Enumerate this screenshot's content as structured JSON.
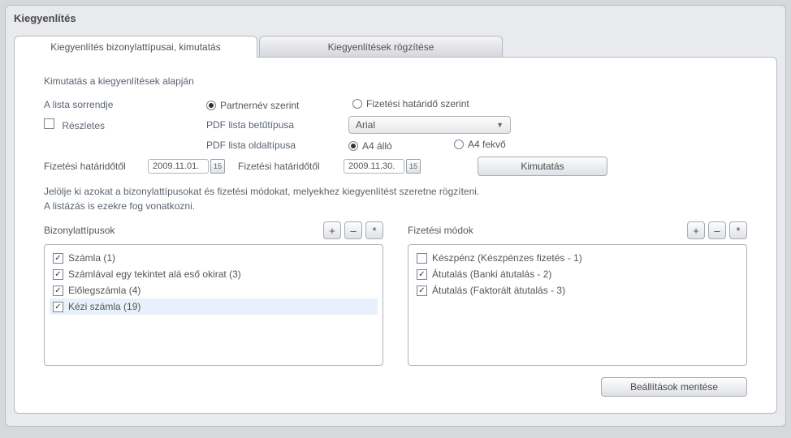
{
  "title": "Kiegyenlítés",
  "tabs": {
    "types": "Kiegyenlítés bizonylattípusai, kimutatás",
    "record": "Kiegyenlítések rögzítése"
  },
  "subtitle": "Kimutatás a kiegyenlítések alapján",
  "labels": {
    "list_order": "A lista sorrendje",
    "detailed": "Részletes",
    "pdf_font": "PDF lista betűtípusa",
    "pdf_page": "PDF lista oldaltípusa",
    "date_from": "Fizetési határidőtől",
    "date_to": "Fizetési határidőtől",
    "doc_types": "Bizonylattípusok",
    "pay_modes": "Fizetési módok"
  },
  "radios": {
    "by_partner": "Partnernév szerint",
    "by_due": "Fizetési határidő szerint",
    "a4_portrait": "A4 álló",
    "a4_landscape": "A4 fekvő"
  },
  "font_select": "Arial",
  "dates": {
    "from": "2009.11.01.",
    "to": "2009.11.30."
  },
  "cal_day": "15",
  "buttons": {
    "report": "Kimutatás",
    "plus": "+",
    "minus": "–",
    "star": "*",
    "save": "Beállítások mentése"
  },
  "hint_line1": "Jelölje ki azokat a bizonylattípusokat és fizetési módokat, melyekhez kiegyenlítést szeretne rögzíteni.",
  "hint_line2": "A listázás is ezekre fog vonatkozni.",
  "doc_types": [
    {
      "label": "Számla (1)",
      "checked": true,
      "selected": false
    },
    {
      "label": "Számlával egy tekintet alá eső okirat (3)",
      "checked": true,
      "selected": false
    },
    {
      "label": "Előlegszámla (4)",
      "checked": true,
      "selected": false
    },
    {
      "label": "Kézi számla (19)",
      "checked": true,
      "selected": true
    }
  ],
  "pay_modes": [
    {
      "label": "Készpénz (Készpénzes fizetés - 1)",
      "checked": false
    },
    {
      "label": "Átutalás (Banki átutalás - 2)",
      "checked": true
    },
    {
      "label": "Átutalás (Faktorált átutalás - 3)",
      "checked": true
    }
  ]
}
